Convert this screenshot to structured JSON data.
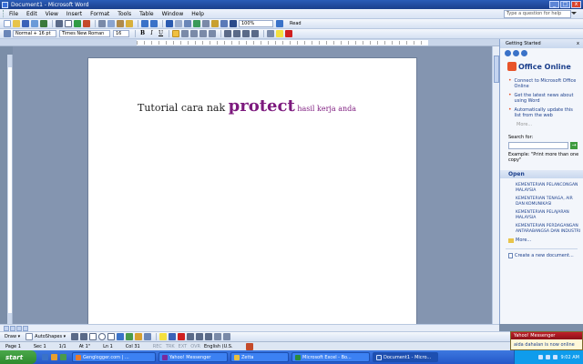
{
  "window": {
    "title": "Document1 - Microsoft Word",
    "min": "_",
    "max": "□",
    "close": "x"
  },
  "menu": {
    "items": [
      "File",
      "Edit",
      "View",
      "Insert",
      "Format",
      "Tools",
      "Table",
      "Window",
      "Help"
    ],
    "help_placeholder": "Type a question for help"
  },
  "toolbar": {
    "zoom": "100%",
    "read": "Read"
  },
  "format": {
    "style": "Normal + 16 pt",
    "font": "Times New Roman",
    "size": "16",
    "bold": "B",
    "italic": "I",
    "underline": "U"
  },
  "document": {
    "part1": "Tutorial cara nak ",
    "part2": "protect",
    "part3": " hasil kerja anda"
  },
  "panel": {
    "title": "Getting Started",
    "close": "x",
    "logo": "Office Online",
    "links": [
      "Connect to Microsoft Office Online",
      "Get the latest news about using Word",
      "Automatically update this list from the web"
    ],
    "more": "More...",
    "search_label": "Search for:",
    "search_go": "→",
    "example": "Example: \"Print more than one copy\"",
    "open_title": "Open",
    "open_items": [
      "KEMENTERIAN PELANCONGAN MALAYSIA",
      "KEMENTERIAN TENAGA, AIR DAN KOMUNIKASI",
      "KEMENTERIAN PELAJARAN MALAYSIA",
      "KEMENTERIAN PERDAGANGAN ANTARABANGSA DAN INDUSTRI"
    ],
    "open_more": "More...",
    "create": "Create a new document..."
  },
  "drawbar": {
    "draw": "Draw ▾",
    "autoshapes": "AutoShapes ▾"
  },
  "status": {
    "page": "Page 1",
    "sec": "Sec 1",
    "pages": "1/1",
    "at": "At 1\"",
    "ln": "Ln 1",
    "col": "Col 31",
    "rec": "REC",
    "trk": "TRK",
    "ext": "EXT",
    "ovr": "OVR",
    "lang": "English (U.S."
  },
  "taskbar": {
    "start": "start",
    "buttons": [
      "Genglogger.com | ...",
      "Yahoo! Messenger",
      "Zetta",
      "Microsoft Excel - Bo...",
      "Document1 - Micro..."
    ],
    "time": "9:02 AM"
  },
  "notification": {
    "title": "Yahoo! Messenger",
    "body": "aida dahalan is now online"
  },
  "colors": {
    "accent": "#7d1a7e",
    "title_blue": "#1b3f8c"
  }
}
